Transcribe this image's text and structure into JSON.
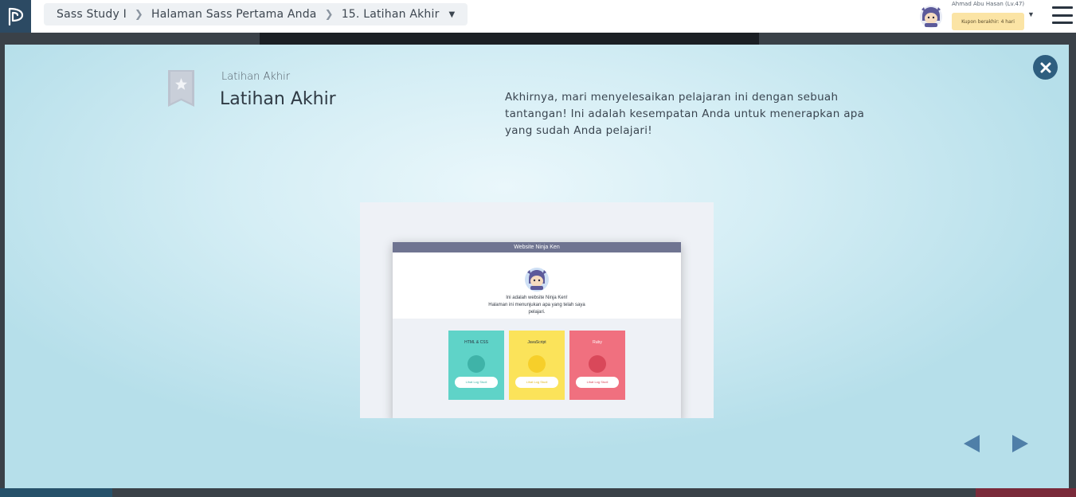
{
  "header": {
    "breadcrumb": [
      {
        "label": "Sass Study I"
      },
      {
        "label": "Halaman Sass Pertama Anda"
      },
      {
        "label": "15. Latihan Akhir"
      }
    ],
    "user_name": "Ahmad Abu Hasan (Lv.47)",
    "coupon_text": "Kupon berakhir: 4 hari"
  },
  "modal": {
    "lesson_label": "Latihan Akhir",
    "lesson_title": "Latihan Akhir",
    "description": "Akhirnya, mari menyelesaikan pelajaran ini dengan sebuah tantangan! Ini adalah kesempatan Anda untuk menerapkan apa yang sudah Anda pelajari!",
    "preview": {
      "site_title": "Website Ninja Ken",
      "intro_line1": "Ini adalah website Ninja Ken!",
      "intro_line2": "Halaman ini menunjukan apa yang telah saya",
      "intro_line3": "pelajari.",
      "cards": [
        {
          "title": "HTML & CSS",
          "button": "Lihat Log Studi",
          "color": "#5fd3c8"
        },
        {
          "title": "JavaScript",
          "button": "Lihat Log Studi",
          "color": "#fbe35a"
        },
        {
          "title": "Ruby",
          "button": "Lihat Log Studi",
          "color": "#f0707f"
        }
      ]
    }
  },
  "icons": {
    "logo": "progate-logo-icon",
    "close": "close-icon",
    "bookmark": "bookmark-star-icon",
    "prev": "prev-arrow-icon",
    "next": "next-arrow-icon",
    "menu": "hamburger-menu-icon"
  },
  "colors": {
    "brand_dark": "#2c4a63",
    "close_button": "#2e5e7f",
    "arrow": "#4f7fa8",
    "coupon_bg": "#fbe4a5"
  }
}
